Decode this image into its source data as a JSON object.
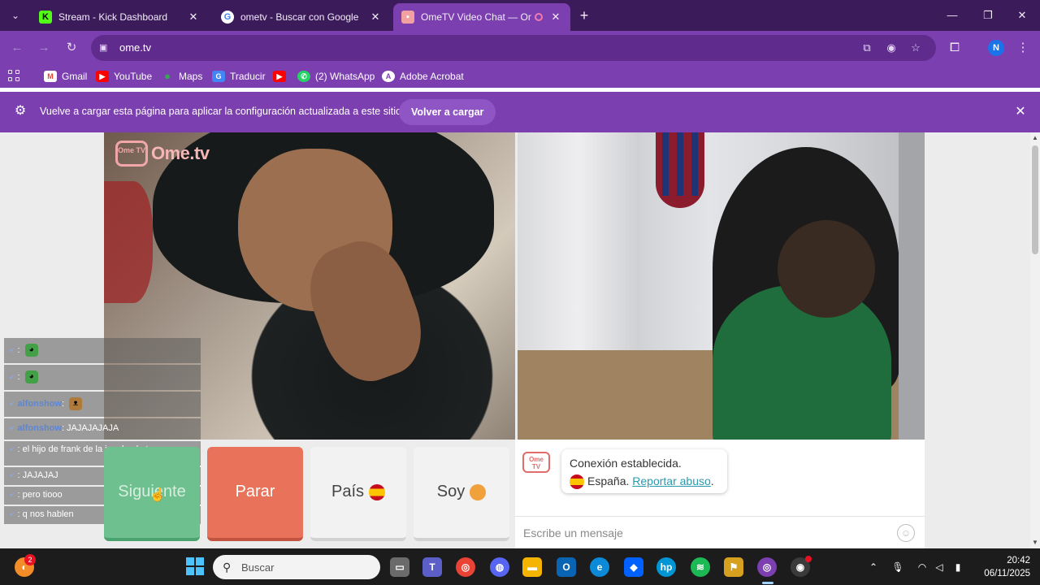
{
  "tabs": [
    {
      "title": "Stream - Kick Dashboard",
      "favicon": "kick-icon"
    },
    {
      "title": "ometv - Buscar con Google",
      "favicon": "google-icon"
    },
    {
      "title": "OmeTV Video Chat — Ome",
      "favicon": "ometv-icon",
      "active": true
    }
  ],
  "toolbar": {
    "url": "ome.tv"
  },
  "bookmarks": [
    {
      "label": "Gmail",
      "icon": "gmail-icon"
    },
    {
      "label": "YouTube",
      "icon": "youtube-icon"
    },
    {
      "label": "Maps",
      "icon": "maps-icon"
    },
    {
      "label": "Traducir",
      "icon": "translate-icon"
    },
    {
      "label": "",
      "icon": "youtube-icon"
    },
    {
      "label": "(2) WhatsApp",
      "icon": "whatsapp-icon"
    },
    {
      "label": "Adobe Acrobat",
      "icon": "acrobat-icon"
    }
  ],
  "infobar": {
    "message": "Vuelve a cargar esta página para aplicar la configuración actualizada a este sitio",
    "button": "Volver a cargar"
  },
  "logo": {
    "tv_text": "Ome TV",
    "text": "Ome.tv"
  },
  "chat_overlay": [
    {
      "user": "",
      "user_color": "red",
      "text": ":",
      "emote": "frog-emote"
    },
    {
      "user": "",
      "user_color": "red",
      "text": ":",
      "emote": "frog-emote"
    },
    {
      "user": "alfonshow",
      "user_color": "blue",
      "text": ":",
      "emote": "cat-emote"
    },
    {
      "user": "alfonshow",
      "user_color": "blue",
      "text": ": JAJAJAJAJA",
      "emote": ""
    },
    {
      "user": "",
      "user_color": "red",
      "text": ": el hijo de frank de la jungla el otro",
      "emote": ""
    },
    {
      "user": "",
      "user_color": "red",
      "text": ": JAJAJAJ",
      "emote": ""
    },
    {
      "user": "",
      "user_color": "red",
      "text": ": pero tiooo",
      "emote": ""
    },
    {
      "user": "",
      "user_color": "red",
      "text": ": q nos hablen",
      "emote": ""
    }
  ],
  "controls": {
    "next": "Siguiente",
    "stop": "Parar",
    "country": "País",
    "iam": "Soy"
  },
  "chat_panel": {
    "status": "Conexión establecida.",
    "country": "España.",
    "report": "Reportar abuso",
    "report_suffix": ".",
    "input_placeholder": "Escribe un mensaje"
  },
  "taskbar": {
    "search_placeholder": "Buscar",
    "notification_count": "2",
    "time": "20:42",
    "date": "06/11/2025"
  },
  "colors": {
    "tabstrip": "#3c1b5a",
    "chrome_purple": "#7b3fb0",
    "next_button": "#6ec18f",
    "stop_button": "#e8735a"
  }
}
